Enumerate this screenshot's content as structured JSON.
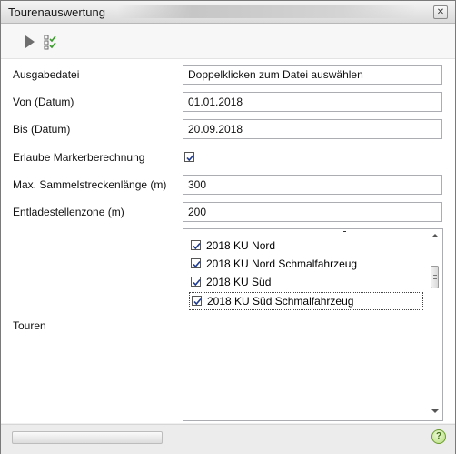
{
  "window": {
    "title": "Tourenauswertung",
    "close_glyph": "✕"
  },
  "toolbar": {
    "run_icon": "play-icon",
    "checklist_icon": "checklist-icon"
  },
  "form": {
    "output_file": {
      "label": "Ausgabedatei",
      "value": "Doppelklicken zum Datei auswählen"
    },
    "from_date": {
      "label": "Von (Datum)",
      "value": "01.01.2018"
    },
    "to_date": {
      "label": "Bis (Datum)",
      "value": "20.09.2018"
    },
    "marker_calc": {
      "label": "Erlaube Markerberechnung",
      "checked": true
    },
    "max_collect": {
      "label": "Max. Sammelstreckenlänge (m)",
      "value": "300"
    },
    "unload_zone": {
      "label": "Entladestellenzone (m)",
      "value": "200"
    },
    "tours": {
      "label": "Touren",
      "items": [
        {
          "label": "2018 KU Nord",
          "checked": true
        },
        {
          "label": "2018 KU Nord Schmalfahrzeug",
          "checked": true
        },
        {
          "label": "2018 KU Süd",
          "checked": true
        },
        {
          "label": "2018 KU Süd Schmalfahrzeug",
          "checked": true
        }
      ]
    }
  },
  "statusbar": {
    "help_glyph": "?"
  }
}
